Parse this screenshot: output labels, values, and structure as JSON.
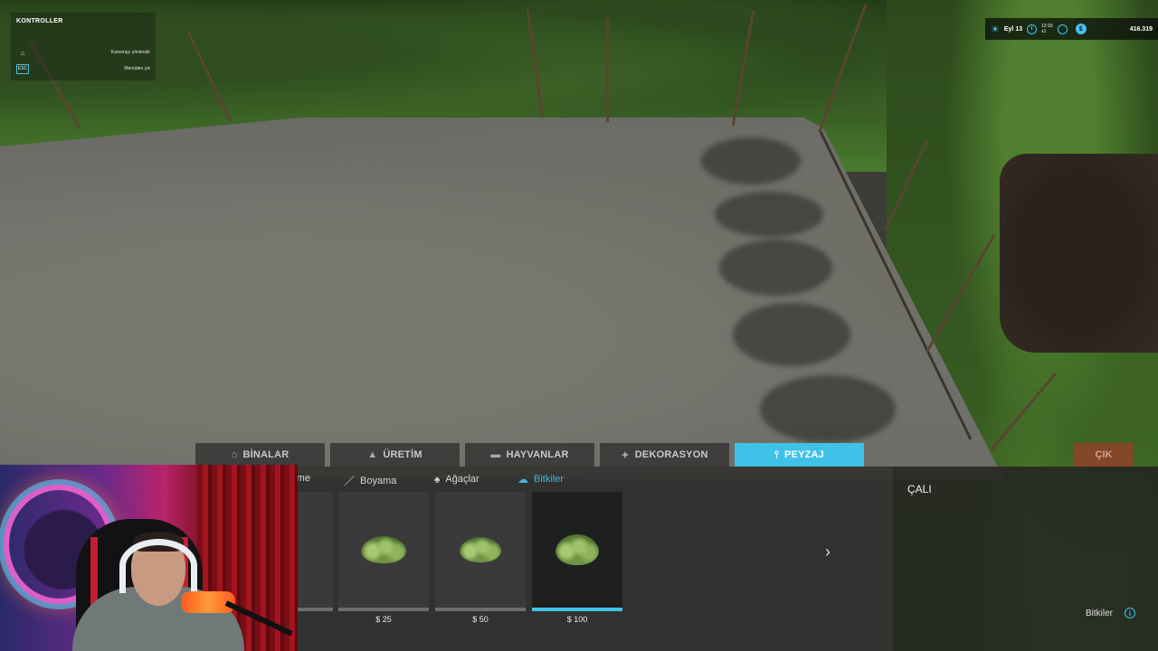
{
  "controls": {
    "title": "KONTROLLER",
    "rows": [
      {
        "key": "⌂",
        "label": "Kamerayı yönlendir"
      },
      {
        "key": "ESC",
        "label": "Menüden çık"
      }
    ]
  },
  "hud": {
    "date": "Eyl 13",
    "time": "12:15",
    "time_sub": "x1",
    "money": "416.319",
    "money_symbol": "$"
  },
  "tabs": [
    {
      "label": "BİNALAR",
      "icon": "building-icon",
      "active": false
    },
    {
      "label": "ÜRETİM",
      "icon": "production-icon",
      "active": false
    },
    {
      "label": "HAYVANLAR",
      "icon": "cow-icon",
      "active": false
    },
    {
      "label": "DEKORASYON",
      "icon": "decoration-icon",
      "active": false
    },
    {
      "label": "PEYZAJ",
      "icon": "landscape-icon",
      "active": true
    }
  ],
  "exit_label": "ÇIK",
  "subtabs": [
    {
      "label": "rme",
      "icon": "",
      "active": false
    },
    {
      "label": "Boyama",
      "icon": "brush-icon",
      "active": false
    },
    {
      "label": "Ağaçlar",
      "icon": "tree-icon",
      "active": false
    },
    {
      "label": "Bitkiler",
      "icon": "plant-icon",
      "active": true
    }
  ],
  "items": [
    {
      "price": "",
      "selected": false
    },
    {
      "price": "$ 25",
      "selected": false
    },
    {
      "price": "$ 50",
      "selected": false
    },
    {
      "price": "$ 100",
      "selected": true
    }
  ],
  "info": {
    "title": "ÇALI",
    "category": "Bitkiler"
  },
  "colors": {
    "accent": "#3fc2e8",
    "exit": "#be2d2d"
  }
}
